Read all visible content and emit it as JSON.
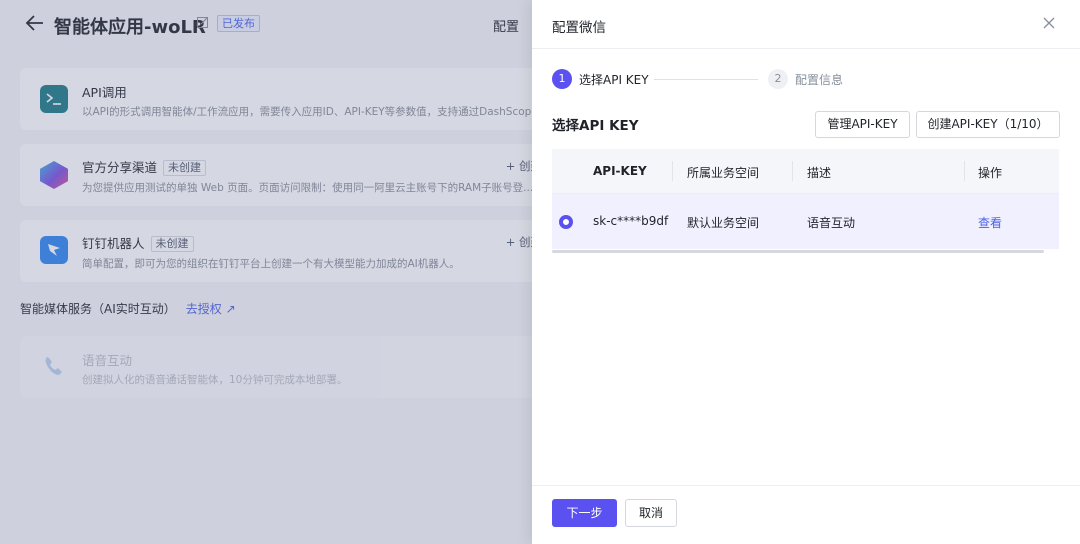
{
  "background": {
    "app_title": "智能体应用-woLR",
    "publish_badge": "已发布",
    "config_tab": "配置",
    "cards": [
      {
        "icon": "terminal-icon",
        "title": "API调用",
        "tag": "",
        "action": "",
        "desc": "以API的形式调用智能体/工作流应用，需要传入应用ID、API-KEY等参数值，支持通过DashScope SDK"
      },
      {
        "icon": "share-channel-icon",
        "title": "官方分享渠道",
        "tag": "未创建",
        "action": "+ 创建",
        "desc": "为您提供应用测试的单独 Web 页面。页面访问限制：使用同一阿里云主账号下的RAM子账号登..."
      },
      {
        "icon": "dingtalk-icon",
        "title": "钉钉机器人",
        "tag": "未创建",
        "action": "+ 创建",
        "desc": "简单配置，即可为您的组织在钉钉平台上创建一个有大模型能力加成的AI机器人。"
      },
      {
        "icon": "phone-icon",
        "title": "语音互动",
        "tag": "",
        "action": "",
        "desc": "创建拟人化的语音通话智能体，10分钟可完成本地部署。"
      }
    ],
    "media_section_title": "智能媒体服务（AI实时互动）",
    "authorize_link": "去授权 ↗"
  },
  "drawer": {
    "title": "配置微信",
    "steps": [
      {
        "num": "1",
        "label": "选择API KEY"
      },
      {
        "num": "2",
        "label": "配置信息"
      }
    ],
    "section_title": "选择API KEY",
    "manage_button": "管理API-KEY",
    "create_button": "创建API-KEY（1/10）",
    "table": {
      "headers": [
        "API-KEY",
        "所属业务空间",
        "描述",
        "操作"
      ],
      "rows": [
        {
          "key": "sk-c****b9df",
          "space": "默认业务空间",
          "desc": "语音互动",
          "action": "查看"
        }
      ]
    },
    "next_button": "下一步",
    "cancel_button": "取消"
  },
  "colors": {
    "accent": "#5b50f0",
    "link": "#4a62e8"
  }
}
